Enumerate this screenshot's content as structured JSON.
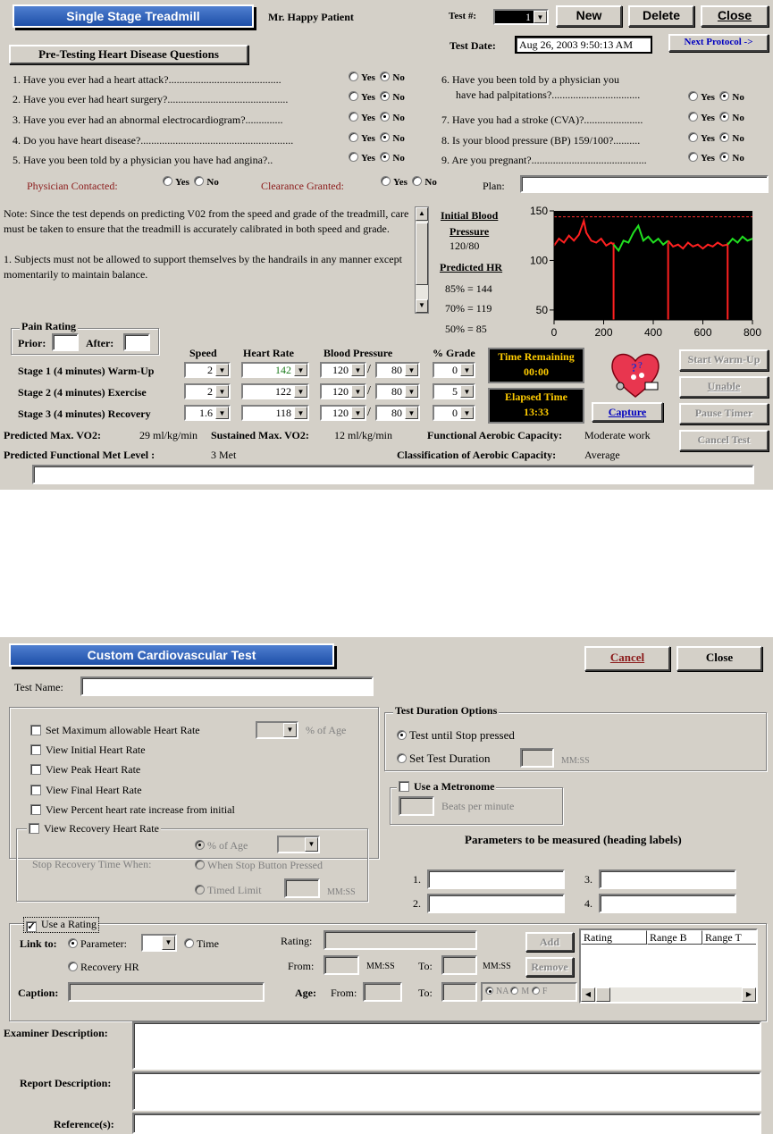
{
  "top": {
    "title": "Single Stage Treadmill",
    "patient": "Mr. Happy Patient",
    "test_num_label": "Test #:",
    "test_num_value": "1",
    "new_label": "New",
    "delete_label": "Delete",
    "close_label": "Close",
    "test_date_label": "Test Date:",
    "test_date_value": "Aug 26, 2003 9:50:13 AM",
    "next_protocol_label": "Next Protocol ->",
    "pretest_label": "Pre-Testing Heart Disease Questions",
    "yes": "Yes",
    "no": "No",
    "questions_left": [
      "1. Have you ever had a heart attack?..........................................",
      "2. Have you ever had heart surgery?.............................................",
      "3. Have you ever had an abnormal electrocardiogram?..............",
      "4. Do you have heart disease?.........................................................",
      "5. Have you been told by a physician you have had angina?.."
    ],
    "questions_right": [
      "6. Have you been told by a physician you",
      "have had palpitations?.................................",
      "7. Have you had a stroke (CVA)?......................",
      "8. Is your blood pressure (BP) 159/100?..........",
      "9. Are you pregnant?..........................................."
    ],
    "physician_contacted": "Physician Contacted:",
    "clearance_granted": "Clearance Granted:",
    "plan_label": "Plan:",
    "note_text": "Note: Since the test depends on predicting V02 from the speed and grade of the treadmill, care must be taken to  ensure that the treadmill is accurately calibrated in both speed and grade.",
    "note_text2": "1.  Subjects must not be allowed to support themselves by the handrails in any manner except momentarily to   maintain balance.",
    "initial_bp_label1": "Initial Blood",
    "initial_bp_label2": "Pressure",
    "initial_bp_value": "120/80",
    "predicted_hr_label": "Predicted HR",
    "hr85": "85% = 144",
    "hr70": "70% = 119",
    "hr50": "50% = 85",
    "pain_rating": "Pain Rating",
    "prior": "Prior:",
    "after": "After:",
    "col_speed": "Speed",
    "col_hr": "Heart Rate",
    "col_bp": "Blood Pressure",
    "col_grade": "% Grade",
    "stages": [
      {
        "label": "Stage 1 (4 minutes) Warm-Up",
        "speed": "2",
        "hr": "142",
        "sys": "120",
        "dia": "80",
        "grade": "0"
      },
      {
        "label": "Stage 2 (4 minutes)  Exercise",
        "speed": "2",
        "hr": "122",
        "sys": "120",
        "dia": "80",
        "grade": "5"
      },
      {
        "label": "Stage 3 (4 minutes)  Recovery",
        "speed": "1.6",
        "hr": "118",
        "sys": "120",
        "dia": "80",
        "grade": "0"
      }
    ],
    "time_remaining_label": "Time Remaining",
    "time_remaining_value": "00:00",
    "elapsed_label": "Elapsed Time",
    "elapsed_value": "13:33",
    "capture_label": "Capture",
    "start_warmup": "Start Warm-Up",
    "unable": "Unable",
    "pause_timer": "Pause Timer",
    "cancel_test": "Cancel Test",
    "pred_max_vo2_label": "Predicted Max. VO2:",
    "pred_max_vo2_value": "29 ml/kg/min",
    "sust_max_vo2_label": "Sustained Max. VO2:",
    "sust_max_vo2_value": "12 ml/kg/min",
    "fac_label": "Functional Aerobic Capacity:",
    "fac_value": "Moderate work",
    "pfml_label": "Predicted Functional  Met Level :",
    "pfml_value": "3 Met",
    "cac_label": "Classification of Aerobic Capacity:",
    "cac_value": "Average"
  },
  "chart_data": {
    "type": "line",
    "xlim": [
      0,
      800
    ],
    "ylim": [
      40,
      150
    ],
    "xticks": [
      "0",
      "200",
      "400",
      "600",
      "800"
    ],
    "yticks": [
      "150",
      "100",
      "50"
    ],
    "threshold": 144,
    "series": [
      {
        "color": "#ff2020",
        "x": [
          0,
          20,
          40,
          60,
          80,
          100,
          120,
          130,
          150,
          170,
          190,
          210,
          230,
          240
        ],
        "y": [
          115,
          122,
          118,
          125,
          120,
          126,
          140,
          128,
          120,
          118,
          122,
          115,
          118,
          116
        ]
      },
      {
        "color": "#20e020",
        "x": [
          240,
          260,
          280,
          300,
          320,
          340,
          360,
          380,
          400,
          420,
          440,
          460
        ],
        "y": [
          116,
          110,
          120,
          118,
          128,
          135,
          120,
          124,
          118,
          122,
          116,
          120
        ]
      },
      {
        "color": "#ff2020",
        "x": [
          460,
          480,
          500,
          520,
          540,
          560,
          580,
          600,
          620,
          640,
          660,
          680,
          700
        ],
        "y": [
          120,
          114,
          116,
          112,
          118,
          114,
          116,
          112,
          116,
          114,
          118,
          115,
          116
        ]
      },
      {
        "color": "#20e020",
        "x": [
          700,
          720,
          740,
          760,
          780,
          800
        ],
        "y": [
          116,
          122,
          118,
          124,
          120,
          122
        ]
      }
    ],
    "markers_x": [
      240,
      460,
      700
    ]
  },
  "bottom": {
    "title": "Custom Cardiovascular Test",
    "cancel_label": "Cancel",
    "close_label": "Close",
    "test_name_label": "Test Name:",
    "set_max_hr": "Set  Maximum allowable Heart Rate",
    "pct_of_age": "% of Age",
    "view_initial": "View Initial Heart Rate",
    "view_peak": "View Peak Heart Rate",
    "view_final": "View Final Heart Rate",
    "view_pct_inc": "View Percent heart rate increase from initial",
    "view_recovery": "View Recovery Heart Rate",
    "stop_recovery": "Stop Recovery Time When:",
    "opt_pct_age": "% of Age",
    "opt_stop_btn": "When Stop Button Pressed",
    "opt_timed": "Timed Limit",
    "mmss": "MM:SS",
    "test_duration": "Test Duration Options",
    "until_stop": "Test until Stop pressed",
    "set_duration": "Set Test Duration",
    "use_metronome": "Use a Metronome",
    "bpm": "Beats per minute",
    "params_heading": "Parameters to be measured (heading labels)",
    "p1": "1.",
    "p2": "2.",
    "p3": "3.",
    "p4": "4.",
    "use_rating": "Use a Rating",
    "link_to": "Link to:",
    "parameter": "Parameter:",
    "time": "Time",
    "recovery_hr": "Recovery HR",
    "caption": "Caption:",
    "rating": "Rating:",
    "from": "From:",
    "to": "To:",
    "age": "Age:",
    "add": "Add",
    "remove": "Remove",
    "na": "NA",
    "m": "M",
    "f": "F",
    "table_headers": [
      "Rating",
      "Range B",
      "Range T"
    ],
    "examiner": "Examiner Description:",
    "report": "Report Description:",
    "references": "Reference(s):"
  }
}
